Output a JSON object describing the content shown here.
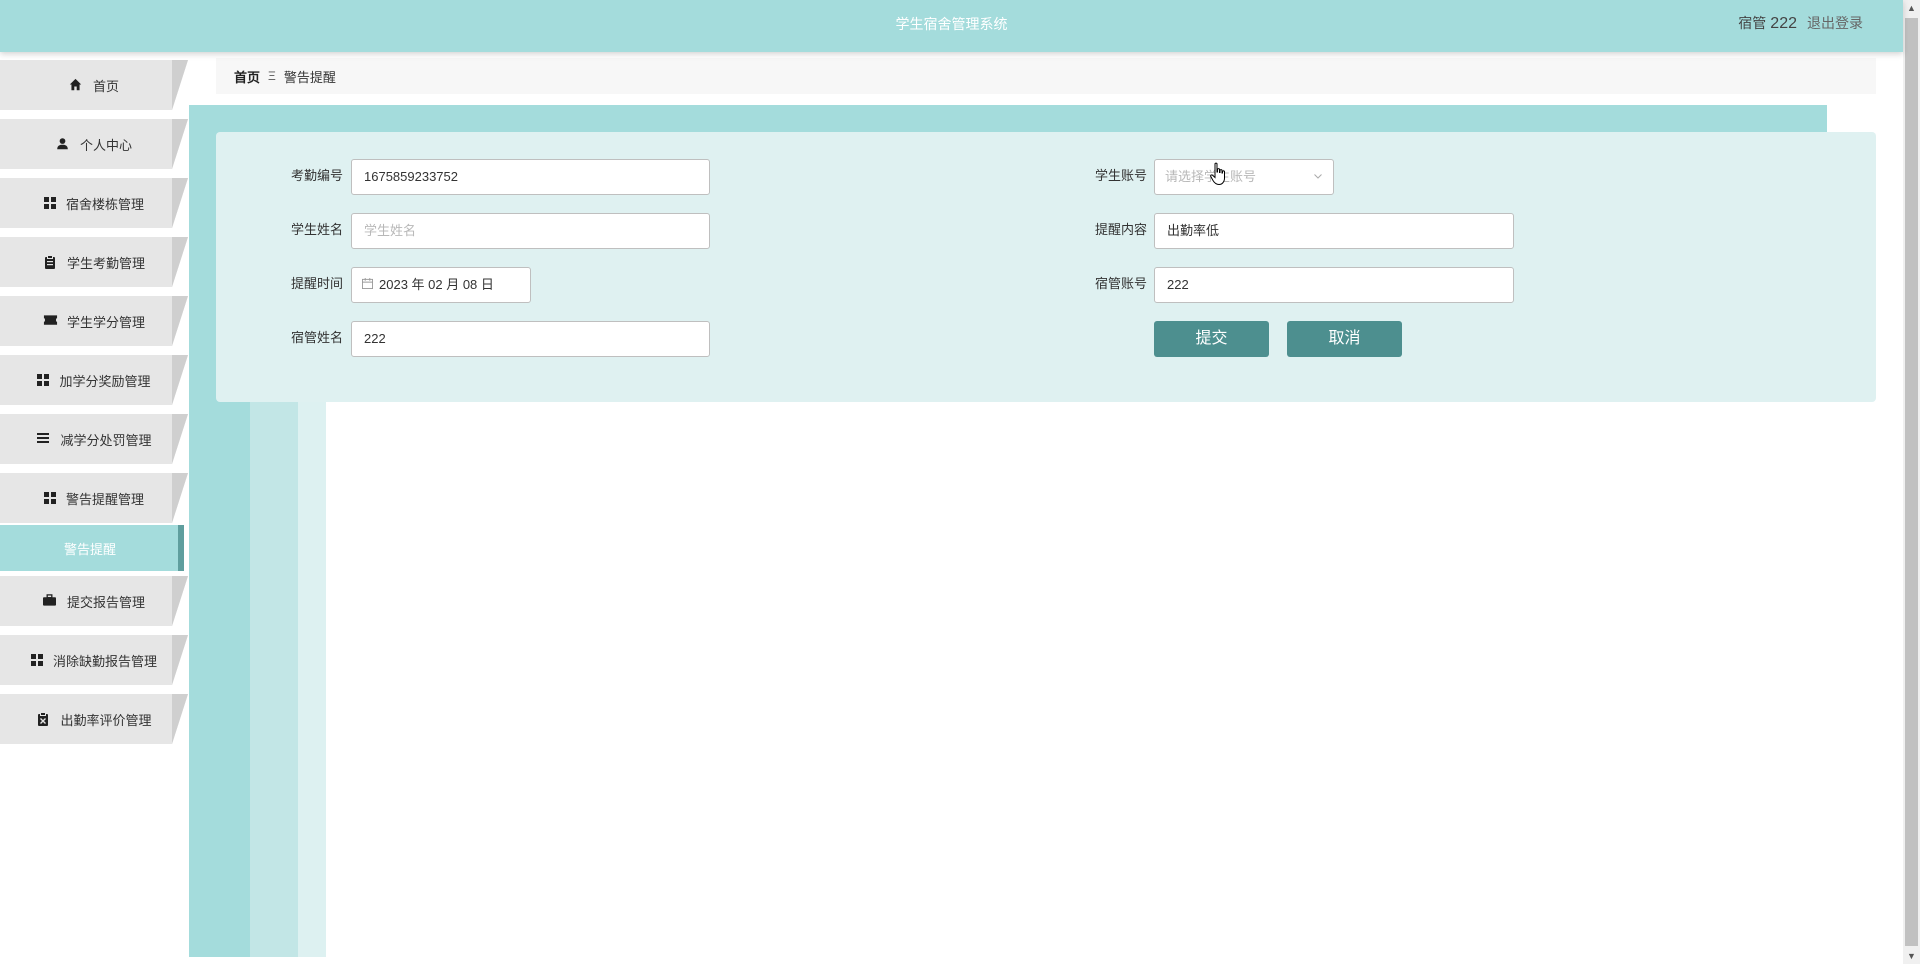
{
  "header": {
    "title": "学生宿舍管理系统",
    "role": "宿管",
    "user_id": "222",
    "logout": "退出登录"
  },
  "sidebar": {
    "items": [
      {
        "label": "首页",
        "icon": "home-icon"
      },
      {
        "label": "个人中心",
        "icon": "user-icon"
      },
      {
        "label": "宿舍楼栋管理",
        "icon": "grid-icon"
      },
      {
        "label": "学生考勤管理",
        "icon": "clipboard-icon"
      },
      {
        "label": "学生学分管理",
        "icon": "ticket-icon"
      },
      {
        "label": "加学分奖励管理",
        "icon": "grid-icon"
      },
      {
        "label": "减学分处罚管理",
        "icon": "list-icon"
      },
      {
        "label": "警告提醒管理",
        "icon": "grid-icon"
      },
      {
        "label": "警告提醒",
        "icon": ""
      },
      {
        "label": "提交报告管理",
        "icon": "briefcase-icon"
      },
      {
        "label": "消除缺勤报告管理",
        "icon": "grid-icon"
      },
      {
        "label": "出勤率评价管理",
        "icon": "clipboard-x-icon"
      }
    ]
  },
  "breadcrumb": {
    "home": "首页",
    "separator": "Ξ",
    "current": "警告提醒"
  },
  "form": {
    "attendance_no": {
      "label": "考勤编号",
      "value": "1675859233752"
    },
    "student_account": {
      "label": "学生账号",
      "placeholder": "请选择学生账号"
    },
    "student_name": {
      "label": "学生姓名",
      "placeholder": "学生姓名"
    },
    "remind_content": {
      "label": "提醒内容",
      "value": "出勤率低"
    },
    "remind_time": {
      "label": "提醒时间",
      "value": "2023 年 02 月 08 日"
    },
    "manager_account": {
      "label": "宿管账号",
      "value": "222"
    },
    "manager_name": {
      "label": "宿管姓名",
      "value": "222"
    },
    "submit": "提交",
    "cancel": "取消"
  },
  "colors": {
    "header": "#a4dcdc",
    "accent": "#4d8f8f",
    "panel": "#dff1f1",
    "menu": "#e6e6e6"
  }
}
